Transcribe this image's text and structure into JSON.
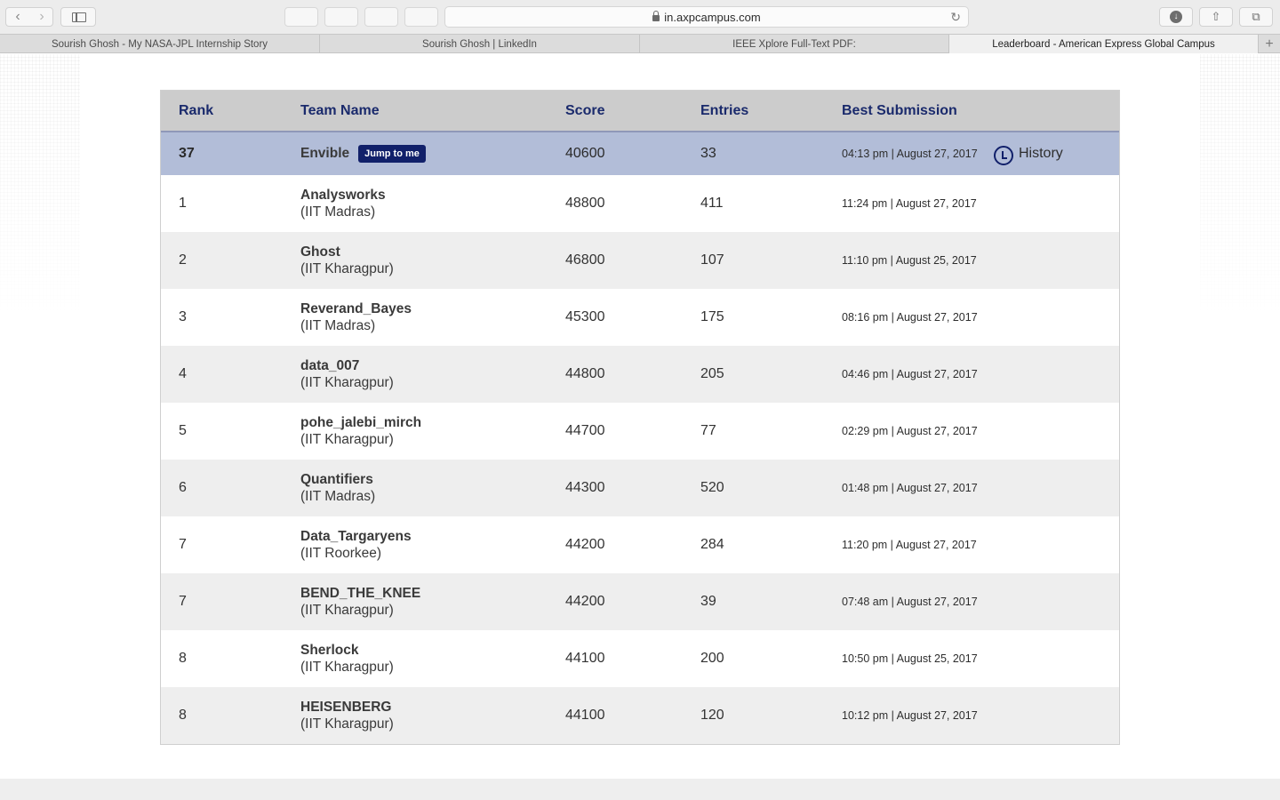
{
  "browser": {
    "address": "in.axpcampus.com",
    "tabs": [
      {
        "label": "Sourish Ghosh - My NASA-JPL Internship Story",
        "active": false
      },
      {
        "label": "Sourish Ghosh | LinkedIn",
        "active": false
      },
      {
        "label": "IEEE Xplore Full-Text PDF:",
        "active": false
      },
      {
        "label": "Leaderboard - American Express Global Campus",
        "active": true
      }
    ],
    "icons": [
      "back-icon",
      "forward-icon",
      "sidebar-icon",
      "lock-icon",
      "reload-icon",
      "download-icon",
      "share-icon",
      "tabs-overview-icon",
      "new-tab-icon"
    ]
  },
  "leaderboard": {
    "headers": {
      "rank": "Rank",
      "team": "Team Name",
      "score": "Score",
      "entries": "Entries",
      "best": "Best Submission"
    },
    "me": {
      "rank": "37",
      "team": "Envible",
      "jump_label": "Jump to me",
      "score": "40600",
      "entries": "33",
      "best": "04:13 pm | August 27, 2017",
      "history_label": "History"
    },
    "rows": [
      {
        "rank": "1",
        "team": "Analysworks",
        "college": "(IIT Madras)",
        "score": "48800",
        "entries": "411",
        "best": "11:24 pm | August 27, 2017"
      },
      {
        "rank": "2",
        "team": "Ghost",
        "college": "(IIT Kharagpur)",
        "score": "46800",
        "entries": "107",
        "best": "11:10 pm | August 25, 2017"
      },
      {
        "rank": "3",
        "team": "Reverand_Bayes",
        "college": "(IIT Madras)",
        "score": "45300",
        "entries": "175",
        "best": "08:16 pm | August 27, 2017"
      },
      {
        "rank": "4",
        "team": "data_007",
        "college": "(IIT Kharagpur)",
        "score": "44800",
        "entries": "205",
        "best": "04:46 pm | August 27, 2017"
      },
      {
        "rank": "5",
        "team": "pohe_jalebi_mirch",
        "college": "(IIT Kharagpur)",
        "score": "44700",
        "entries": "77",
        "best": "02:29 pm | August 27, 2017"
      },
      {
        "rank": "6",
        "team": "Quantifiers",
        "college": "(IIT Madras)",
        "score": "44300",
        "entries": "520",
        "best": "01:48 pm | August 27, 2017"
      },
      {
        "rank": "7",
        "team": "Data_Targaryens",
        "college": "(IIT Roorkee)",
        "score": "44200",
        "entries": "284",
        "best": "11:20 pm | August 27, 2017"
      },
      {
        "rank": "7",
        "team": "BEND_THE_KNEE",
        "college": "(IIT Kharagpur)",
        "score": "44200",
        "entries": "39",
        "best": "07:48 am | August 27, 2017"
      },
      {
        "rank": "8",
        "team": "Sherlock",
        "college": "(IIT Kharagpur)",
        "score": "44100",
        "entries": "200",
        "best": "10:50 pm | August 25, 2017"
      },
      {
        "rank": "8",
        "team": "HEISENBERG",
        "college": "(IIT Kharagpur)",
        "score": "44100",
        "entries": "120",
        "best": "10:12 pm | August 27, 2017"
      }
    ]
  },
  "colors": {
    "header_bg": "#cccccc",
    "header_text": "#1a2a6c",
    "me_row_bg": "#b2bdd8",
    "jump_btn_bg": "#11206a",
    "row_alt_bg": "#eeeeee"
  }
}
